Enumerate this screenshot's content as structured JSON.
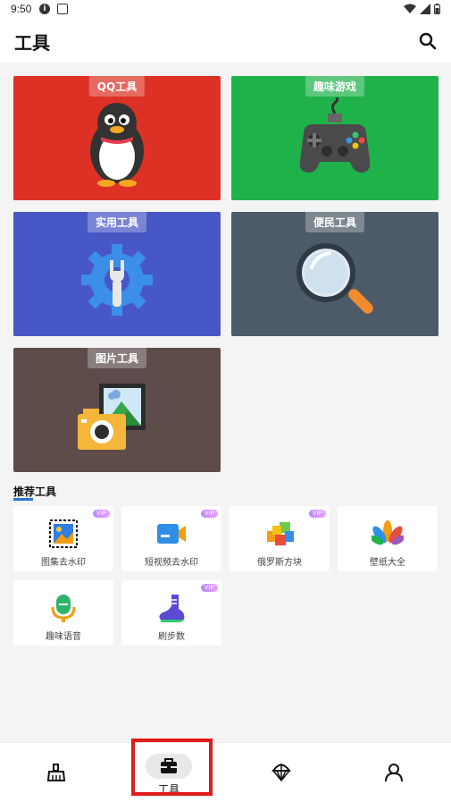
{
  "status_bar": {
    "time": "9:50"
  },
  "header": {
    "title": "工具",
    "search_icon": "search-icon"
  },
  "categories": [
    {
      "label": "QQ工具",
      "color": "#de3126",
      "icon": "penguin-icon"
    },
    {
      "label": "趣味游戏",
      "color": "#1fb24b",
      "icon": "gamepad-icon"
    },
    {
      "label": "实用工具",
      "color": "#4857c6",
      "icon": "wrench-gear-icon"
    },
    {
      "label": "便民工具",
      "color": "#4d5a67",
      "icon": "magnifier-icon"
    },
    {
      "label": "图片工具",
      "color": "#5e4c4b",
      "icon": "camera-picture-icon"
    }
  ],
  "recommended": {
    "title": "推荐工具",
    "items": [
      {
        "label": "图集去水印",
        "badge": "VIP",
        "icon": "image-crop-icon"
      },
      {
        "label": "短视频去水印",
        "badge": "VIP",
        "icon": "video-camera-icon"
      },
      {
        "label": "俄罗斯方块",
        "badge": "VIP",
        "icon": "blocks-icon"
      },
      {
        "label": "壁纸大全",
        "badge": "",
        "icon": "flower-icon"
      },
      {
        "label": "趣味语音",
        "badge": "",
        "icon": "microphone-icon"
      },
      {
        "label": "刷步数",
        "badge": "VIP",
        "icon": "sneaker-icon"
      }
    ]
  },
  "bottom_nav": {
    "items": [
      {
        "label": "",
        "icon": "broom-icon"
      },
      {
        "label": "工具",
        "icon": "toolbox-icon",
        "active": true
      },
      {
        "label": "",
        "icon": "parachute-icon"
      },
      {
        "label": "",
        "icon": "profile-icon"
      }
    ]
  },
  "colors": {
    "accent": "#2b74d8",
    "highlight": "#e01b1b"
  }
}
